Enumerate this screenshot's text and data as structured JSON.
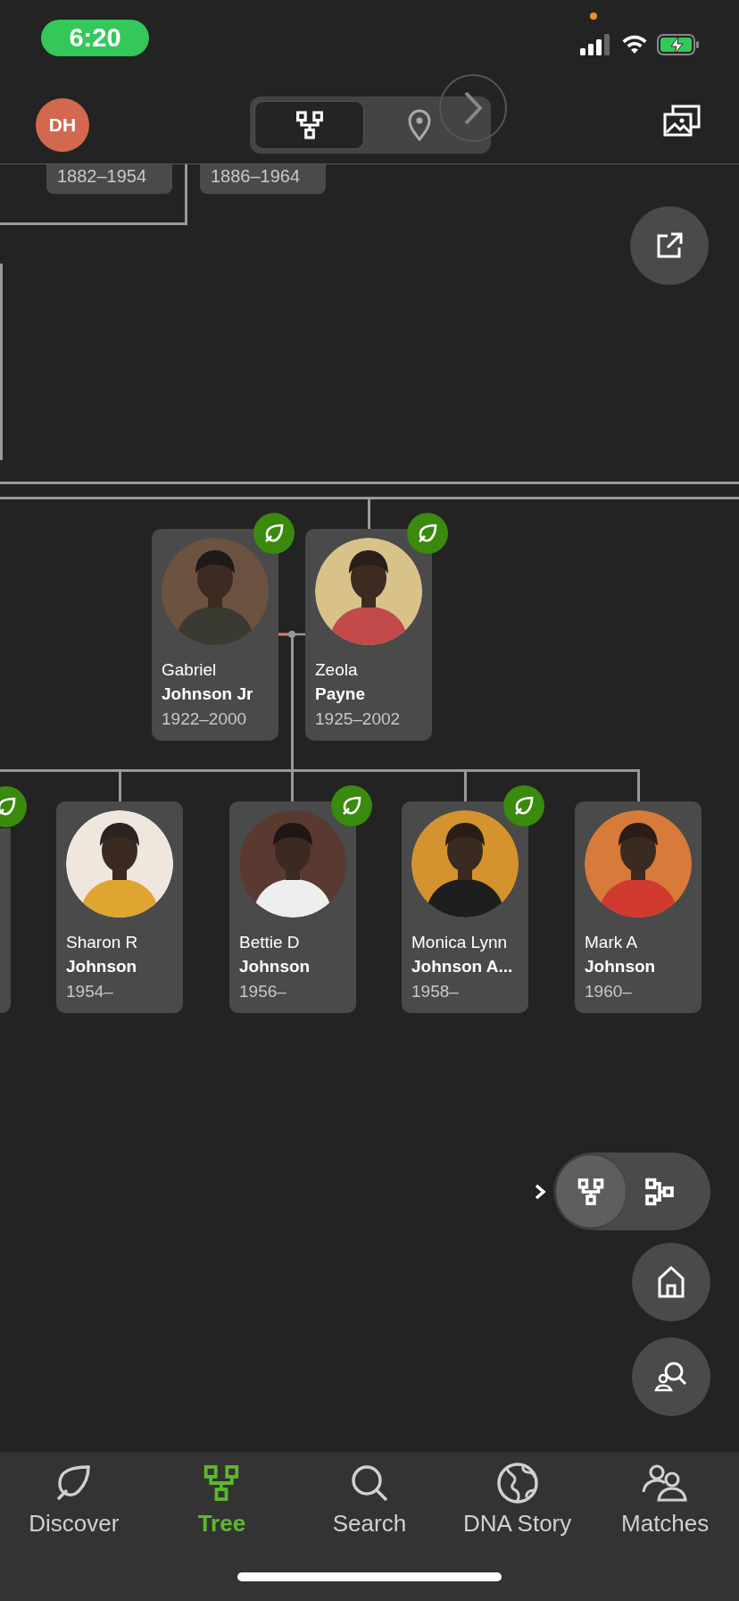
{
  "status_bar": {
    "time": "6:20"
  },
  "header": {
    "avatar_initials": "DH",
    "view_toggle": [
      {
        "kind": "tree",
        "selected": true
      },
      {
        "kind": "map",
        "selected": false
      }
    ]
  },
  "top_cards": [
    {
      "years": "1882–1954"
    },
    {
      "years": "1886–1964"
    }
  ],
  "parents": [
    {
      "first_name": "Gabriel",
      "last_name": "Johnson Jr",
      "years": "1922–2000",
      "hint": true
    },
    {
      "first_name": "Zeola",
      "last_name": "Payne",
      "years": "1925–2002",
      "hint": true
    }
  ],
  "children": [
    {
      "kind": "partial",
      "hint": true
    },
    {
      "first_name": "Sharon R",
      "last_name": "Johnson",
      "years": "1954–",
      "hint": false
    },
    {
      "first_name": "Bettie D",
      "last_name": "Johnson",
      "years": "1956–",
      "hint": true
    },
    {
      "first_name": "Monica Lynn",
      "last_name": "Johnson A...",
      "years": "1958–",
      "hint": true
    },
    {
      "first_name": "Mark A",
      "last_name": "Johnson",
      "years": "1960–",
      "hint": false
    }
  ],
  "layout_toggle": [
    {
      "kind": "vertical",
      "selected": true
    },
    {
      "kind": "horizontal",
      "selected": false
    }
  ],
  "tabs": [
    {
      "kind": "discover",
      "label": "Discover",
      "selected": false
    },
    {
      "kind": "tree",
      "label": "Tree",
      "selected": true
    },
    {
      "kind": "search",
      "label": "Search",
      "selected": false
    },
    {
      "kind": "dna",
      "label": "DNA Story",
      "selected": false
    },
    {
      "kind": "matches",
      "label": "Matches",
      "selected": false
    }
  ]
}
